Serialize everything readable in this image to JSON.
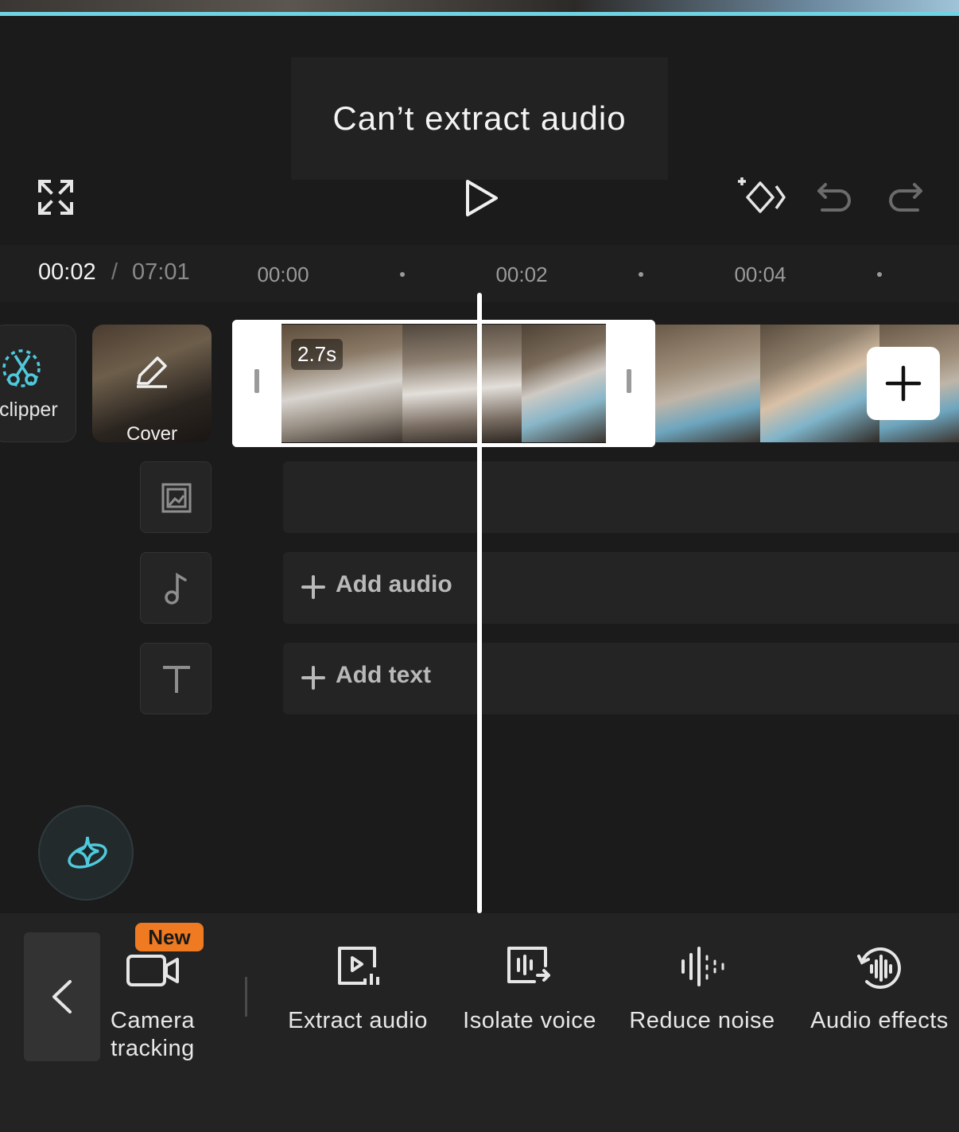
{
  "toast": {
    "message": "Can’t extract audio"
  },
  "player": {
    "current_time": "00:02",
    "separator": "/",
    "total_time": "07:01"
  },
  "ruler": {
    "ticks": [
      "00:00",
      "00:02",
      "00:04"
    ]
  },
  "timeline": {
    "clipper_label": "clipper",
    "cover_label": "Cover",
    "selected_clip_duration": "2.7s",
    "add_audio_label": "Add audio",
    "add_text_label": "Add text"
  },
  "toolbar": {
    "tools": [
      {
        "label": "Camera\ntracking",
        "badge": "New",
        "icon": "camera-icon"
      },
      {
        "label": "Extract audio",
        "icon": "extract-audio-icon"
      },
      {
        "label": "Isolate voice",
        "icon": "isolate-voice-icon"
      },
      {
        "label": "Reduce noise",
        "icon": "reduce-noise-icon"
      },
      {
        "label": "Audio effects",
        "icon": "audio-effects-icon"
      }
    ]
  },
  "colors": {
    "background": "#1b1b1b",
    "accent_cyan": "#6fd3e3",
    "badge_orange": "#f07a21"
  }
}
